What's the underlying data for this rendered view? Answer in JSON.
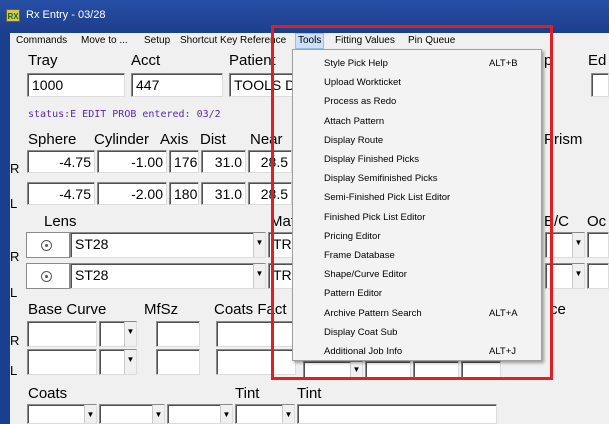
{
  "window": {
    "title": "Rx Entry - 03/28",
    "icon_label": "RX"
  },
  "menubar": [
    "Commands",
    "Move to ...",
    "Setup",
    "Shortcut Key Reference",
    "Tools",
    "Fitting Values",
    "Pin Queue"
  ],
  "header": {
    "tray_label": "Tray",
    "tray_value": "1000",
    "acct_label": "Acct",
    "acct_value": "447",
    "patient_label": "Patient",
    "patient_value": "TOOLS D",
    "partial_label_p": "p",
    "partial_label_ed": "Ed"
  },
  "status_line": "status:E EDIT PROB  entered: 03/2",
  "rx_headers": {
    "sphere": "Sphere",
    "cylinder": "Cylinder",
    "axis": "Axis",
    "dist": "Dist",
    "near": "Near",
    "prism": "Prism"
  },
  "rx_rows": [
    {
      "eye": "R",
      "sphere": "-4.75",
      "cylinder": "-1.00",
      "axis": "176",
      "dist": "31.0",
      "near": "28.5"
    },
    {
      "eye": "L",
      "sphere": "-4.75",
      "cylinder": "-2.00",
      "axis": "180",
      "dist": "31.0",
      "near": "28.5"
    }
  ],
  "lens": {
    "label": "Lens",
    "mat_partial": "Mat",
    "bc_label": "B/C",
    "oc_partial": "Oc",
    "rows": [
      {
        "eye": "R",
        "value": "ST28",
        "mat": "TR"
      },
      {
        "eye": "L",
        "value": "ST28",
        "mat": "TR"
      }
    ]
  },
  "base": {
    "base_curve": "Base Curve",
    "mfsz": "MfSz",
    "coats_fact": "Coats Fact",
    "partial_ce": "ce",
    "eye_r": "R",
    "eye_l": "L"
  },
  "bottom": {
    "coats": "Coats",
    "tint1": "Tint",
    "tint2": "Tint"
  },
  "tools_menu": [
    {
      "label": "Style Pick Help",
      "shortcut": "ALT+B"
    },
    {
      "label": "Upload Workticket",
      "shortcut": ""
    },
    {
      "label": "Process as Redo",
      "shortcut": ""
    },
    {
      "label": "Attach Pattern",
      "shortcut": ""
    },
    {
      "label": "Display Route",
      "shortcut": ""
    },
    {
      "label": "Display Finished Picks",
      "shortcut": ""
    },
    {
      "label": "Display Semifinished Picks",
      "shortcut": ""
    },
    {
      "label": "Semi-Finished Pick List Editor",
      "shortcut": ""
    },
    {
      "label": "Finished Pick List Editor",
      "shortcut": ""
    },
    {
      "label": "Pricing Editor",
      "shortcut": ""
    },
    {
      "label": "Frame Database",
      "shortcut": ""
    },
    {
      "label": "Shape/Curve Editor",
      "shortcut": ""
    },
    {
      "label": "Pattern Editor",
      "shortcut": ""
    },
    {
      "label": "Archive Pattern Search",
      "shortcut": "ALT+A"
    },
    {
      "label": "Display Coat Sub",
      "shortcut": ""
    },
    {
      "label": "Additional Job Info",
      "shortcut": "ALT+J"
    }
  ],
  "colors": {
    "desktop": "#1b3f8f",
    "highlight": "#e02020",
    "status_text": "#5a2aa8"
  },
  "icons": {
    "app": "rx-app-icon",
    "lens_option": "radio-dot-icon",
    "dropdown": "chevron-down-icon"
  }
}
